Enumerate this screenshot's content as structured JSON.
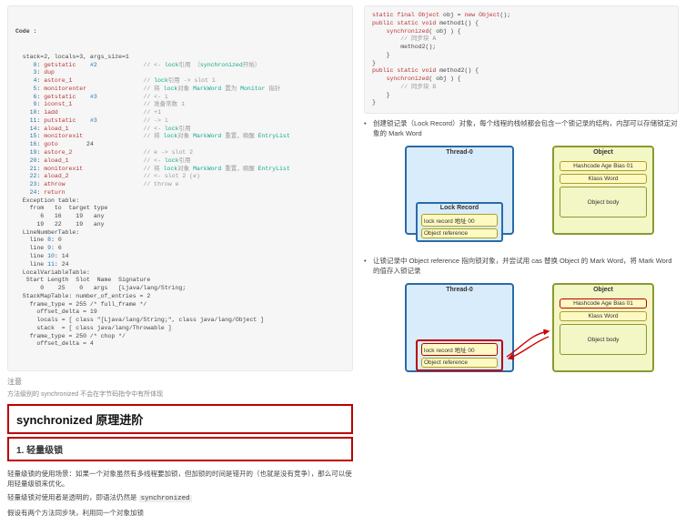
{
  "left": {
    "code_header": "Code :",
    "code_lines": [
      {
        "l": "  stack=2, locals=3, args_size=1"
      },
      {
        "l": "     0: getstatic    #2",
        "c": "// <- lock引用 （synchronized开始）"
      },
      {
        "l": "     3: dup"
      },
      {
        "l": "     4: astore_1",
        "c": "// lock引用 -> slot 1"
      },
      {
        "l": "     5: monitorenter",
        "c": "// 将 lock对象 MarkWord 置为 Monitor 指针"
      },
      {
        "l": "     6: getstatic    #3",
        "c": "// <- i"
      },
      {
        "l": "     9: iconst_1",
        "c": "// 准备常数 1"
      },
      {
        "l": "    10: iadd",
        "c": "// +1"
      },
      {
        "l": "    11: putstatic    #3",
        "c": "// -> i"
      },
      {
        "l": "    14: aload_1",
        "c": "// <- lock引用"
      },
      {
        "l": "    15: monitorexit",
        "c": "// 将 lock对象 MarkWord 重置，唤醒 EntryList"
      },
      {
        "l": "    16: goto        24"
      },
      {
        "l": "    19: astore_2",
        "c": "// e -> slot 2"
      },
      {
        "l": "    20: aload_1",
        "c": "// <- lock引用"
      },
      {
        "l": "    21: monitorexit",
        "c": "// 将 lock对象 MarkWord 重置，唤醒 EntryList"
      },
      {
        "l": "    22: aload_2",
        "c": "// <- slot 2 (e)"
      },
      {
        "l": "    23: athrow",
        "c": "// throw e"
      },
      {
        "l": "    24: return"
      },
      {
        "l": "  Exception table:"
      },
      {
        "l": "    from   to  target type"
      },
      {
        "l": "       6   16    19   any"
      },
      {
        "l": "      19   22    19   any"
      },
      {
        "l": "  LineNumberTable:"
      },
      {
        "l": "    line 8: 0"
      },
      {
        "l": "    line 9: 6"
      },
      {
        "l": "    line 10: 14"
      },
      {
        "l": "    line 11: 24"
      },
      {
        "l": "  LocalVariableTable:"
      },
      {
        "l": "   Start Length  Slot  Name  Signature"
      },
      {
        "l": "       0    25    0   args   [Ljava/lang/String;"
      },
      {
        "l": "  StackMapTable: number_of_entries = 2"
      },
      {
        "l": "    frame_type = 255 /* full_frame */"
      },
      {
        "l": "      offset_delta = 19"
      },
      {
        "l": "      locals = [ class \"[Ljava/lang/String;\", class java/lang/Object ]"
      },
      {
        "l": "      stack  = [ class java/lang/Throwable ]"
      },
      {
        "l": "    frame_type = 250 /* chop */"
      },
      {
        "l": "      offset_delta = 4"
      }
    ],
    "note_label": "注意",
    "note_text": "方法级别的 synchronized 不会在字节码指令中有所体现",
    "h2": "synchronized 原理进阶",
    "h3": "1. 轻量级锁",
    "p1": "轻量级锁的使用场景：如果一个对象虽然有多线程要加锁，但加锁的时间是错开的（也就是没有竞争），那么可以使用轻量级锁来优化。",
    "p2_a": "轻量级锁对使用者是透明的，即语法仍然是 ",
    "p2_code": "synchronized",
    "p3": "假设有两个方法同步块，利用同一个对象加锁"
  },
  "right": {
    "code_lines": [
      "static final Object obj = new Object();",
      "public static void method1() {",
      "    synchronized( obj ) {",
      "        // 同步块 A",
      "        method2();",
      "    }",
      "}",
      "public static void method2() {",
      "    synchronized( obj ) {",
      "        // 同步块 B",
      "    }",
      "}"
    ],
    "bullet1": "创建锁记录（Lock Record）对象，每个线程的栈帧都会包含一个锁记录的结构，内部可以存储锁定对象的 Mark Word",
    "bullet2": "让锁记录中 Object reference 指向锁对象，并尝试用 cas 替换 Object 的 Mark Word，将 Mark Word 的值存入锁记录",
    "diagram": {
      "thread_title": "Thread-0",
      "object_title": "Object",
      "obj_row1": "Hashcode Age Bias 01",
      "obj_row2": "Klass Word",
      "obj_body": "Object body",
      "lock_rec_title": "Lock Record",
      "lr_row1": "lock record 地址 00",
      "lr_row2": "Object reference"
    }
  }
}
